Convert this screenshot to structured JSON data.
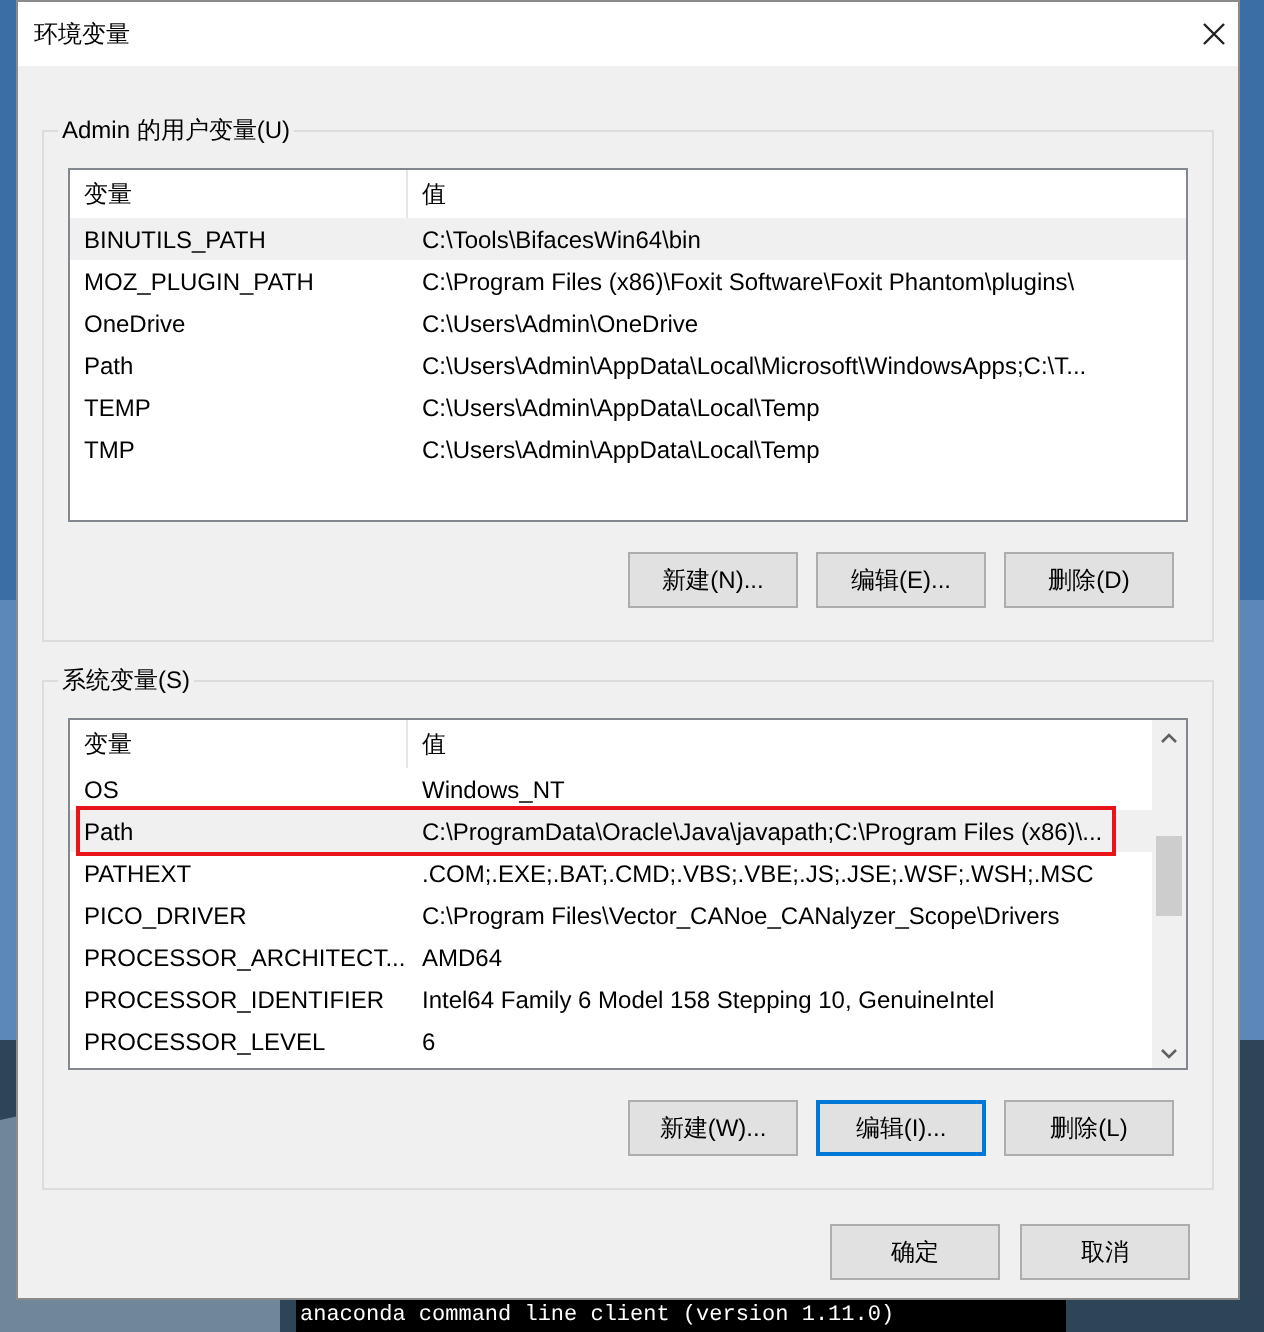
{
  "window": {
    "title": "环境变量"
  },
  "user_variables": {
    "title": "Admin 的用户变量(U)",
    "columns": [
      "变量",
      "值"
    ],
    "rows": [
      {
        "name": "BINUTILS_PATH",
        "value": "C:\\Tools\\BifacesWin64\\bin",
        "selected": true,
        "annotated": false
      },
      {
        "name": "MOZ_PLUGIN_PATH",
        "value": "C:\\Program Files (x86)\\Foxit Software\\Foxit Phantom\\plugins\\",
        "selected": false,
        "annotated": false
      },
      {
        "name": "OneDrive",
        "value": "C:\\Users\\Admin\\OneDrive",
        "selected": false,
        "annotated": false
      },
      {
        "name": "Path",
        "value": "C:\\Users\\Admin\\AppData\\Local\\Microsoft\\WindowsApps;C:\\T...",
        "selected": false,
        "annotated": false
      },
      {
        "name": "TEMP",
        "value": "C:\\Users\\Admin\\AppData\\Local\\Temp",
        "selected": false,
        "annotated": false
      },
      {
        "name": "TMP",
        "value": "C:\\Users\\Admin\\AppData\\Local\\Temp",
        "selected": false,
        "annotated": false
      }
    ],
    "buttons": [
      {
        "label": "新建(N)...",
        "focused": false
      },
      {
        "label": "编辑(E)...",
        "focused": false
      },
      {
        "label": "删除(D)",
        "focused": false
      }
    ]
  },
  "system_variables": {
    "title": "系统变量(S)",
    "columns": [
      "变量",
      "值"
    ],
    "rows": [
      {
        "name": "OS",
        "value": "Windows_NT",
        "selected": false,
        "annotated": false
      },
      {
        "name": "Path",
        "value": "C:\\ProgramData\\Oracle\\Java\\javapath;C:\\Program Files (x86)\\...",
        "selected": true,
        "annotated": true
      },
      {
        "name": "PATHEXT",
        "value": ".COM;.EXE;.BAT;.CMD;.VBS;.VBE;.JS;.JSE;.WSF;.WSH;.MSC",
        "selected": false,
        "annotated": false
      },
      {
        "name": "PICO_DRIVER",
        "value": "C:\\Program Files\\Vector_CANoe_CANalyzer_Scope\\Drivers",
        "selected": false,
        "annotated": false
      },
      {
        "name": "PROCESSOR_ARCHITECT...",
        "value": "AMD64",
        "selected": false,
        "annotated": false
      },
      {
        "name": "PROCESSOR_IDENTIFIER",
        "value": "Intel64 Family 6 Model 158 Stepping 10, GenuineIntel",
        "selected": false,
        "annotated": false
      },
      {
        "name": "PROCESSOR_LEVEL",
        "value": "6",
        "selected": false,
        "annotated": false
      }
    ],
    "buttons": [
      {
        "label": "新建(W)...",
        "focused": false
      },
      {
        "label": "编辑(I)...",
        "focused": true
      },
      {
        "label": "删除(L)",
        "focused": false
      }
    ]
  },
  "dialog_buttons": [
    {
      "label": "确定",
      "focused": false
    },
    {
      "label": "取消",
      "focused": false
    }
  ],
  "console": {
    "text": "anaconda command line client (version 1.11.0)"
  }
}
